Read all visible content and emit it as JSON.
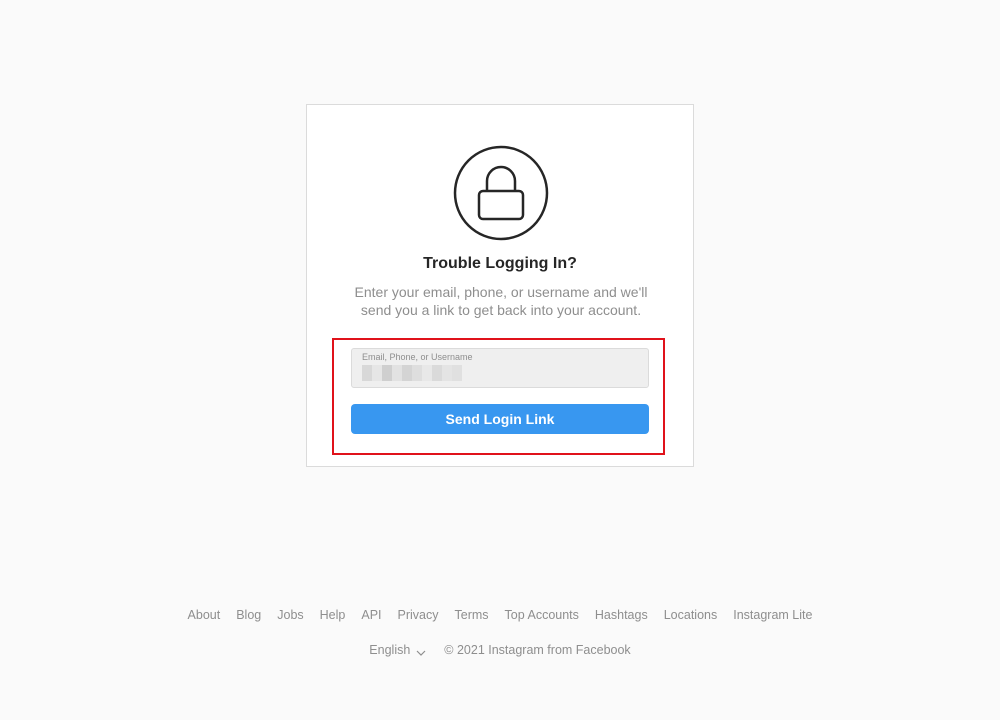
{
  "card": {
    "title": "Trouble Logging In?",
    "description": "Enter your email, phone, or username and we'll send you a link to get back into your account.",
    "lock_icon": "lock-icon"
  },
  "form": {
    "input_label": "Email, Phone, or Username",
    "input_value_obscured": true,
    "send_label": "Send Login Link"
  },
  "footer": {
    "links": [
      "About",
      "Blog",
      "Jobs",
      "Help",
      "API",
      "Privacy",
      "Terms",
      "Top Accounts",
      "Hashtags",
      "Locations",
      "Instagram Lite"
    ],
    "language": "English",
    "copyright": "© 2021 Instagram from Facebook"
  },
  "colors": {
    "button": "#3897f0",
    "highlight": "#e0121b",
    "background": "#fafafa"
  }
}
